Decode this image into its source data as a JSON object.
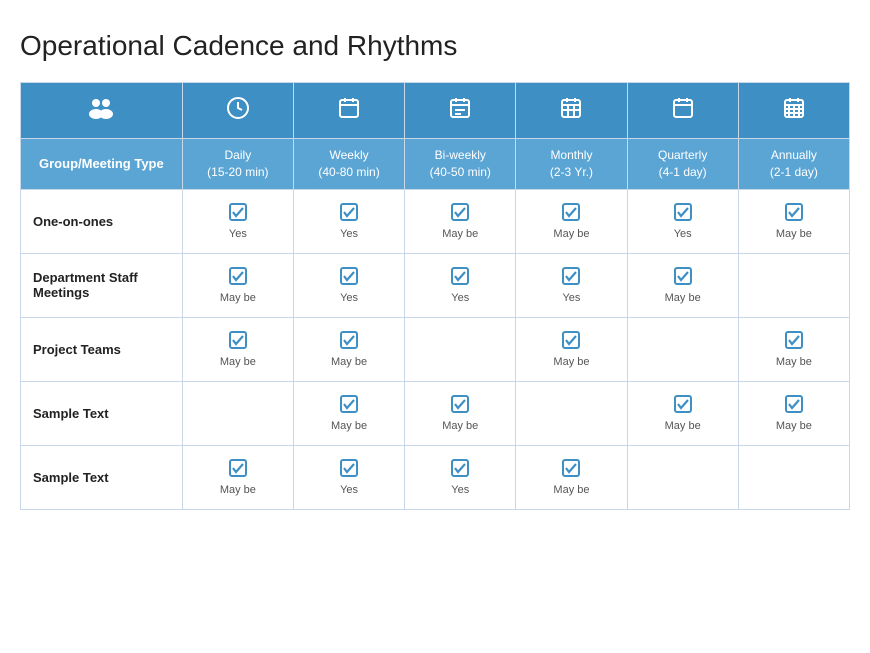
{
  "page": {
    "title": "Operational Cadence and Rhythms"
  },
  "table": {
    "icons": [
      "👥",
      "🕐",
      "📅",
      "📅",
      "📅",
      "📅",
      "📅"
    ],
    "icon_names": [
      "group-icon",
      "clock-icon",
      "weekly-icon",
      "biweekly-icon",
      "monthly-icon",
      "quarterly-icon",
      "annually-icon"
    ],
    "headers": [
      "Group/Meeting Type",
      "Daily\n(15-20 min)",
      "Weekly\n(40-80 min)",
      "Bi-weekly\n(40-50 min)",
      "Monthly\n(2-3 Yr.)",
      "Quarterly\n(4-1 day)",
      "Annually\n(2-1 day)"
    ],
    "rows": [
      {
        "name": "One-on-ones",
        "cells": [
          "Yes",
          "Yes",
          "May be",
          "May be",
          "Yes",
          "May be"
        ]
      },
      {
        "name": "Department Staff\nMeetings",
        "cells": [
          "May be",
          "Yes",
          "Yes",
          "Yes",
          "May be",
          ""
        ]
      },
      {
        "name": "Project Teams",
        "cells": [
          "May be",
          "May be",
          "",
          "May be",
          "",
          "May be"
        ]
      },
      {
        "name": "Sample Text",
        "cells": [
          "",
          "May be",
          "May be",
          "",
          "May be",
          "May be"
        ]
      },
      {
        "name": "Sample Text",
        "cells": [
          "May be",
          "Yes",
          "Yes",
          "May be",
          "",
          ""
        ]
      }
    ]
  }
}
